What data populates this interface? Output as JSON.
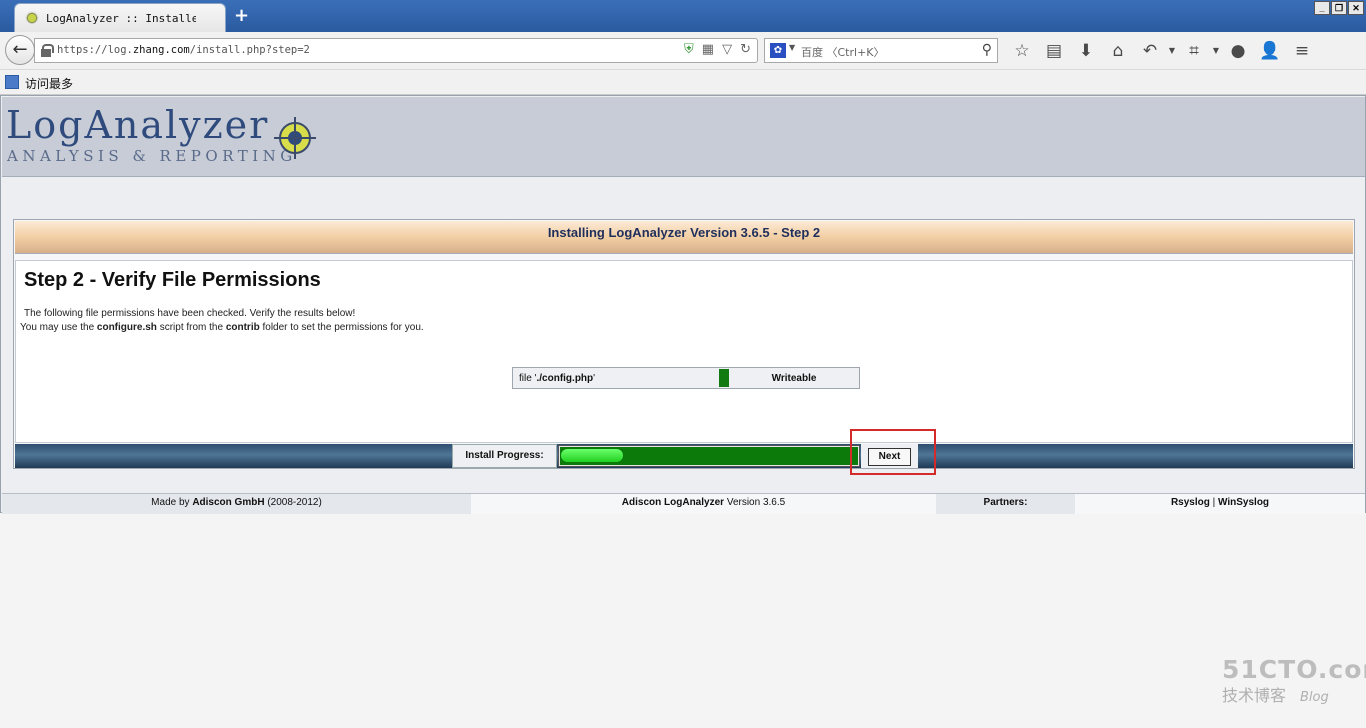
{
  "browser": {
    "tab_title": "LogAnalyzer :: Installe…",
    "new_tab_symbol": "+",
    "url_prefix": "https://log.",
    "url_host": "zhang.com",
    "url_path": "/install.php?step=2",
    "search_placeholder": "百度 〈Ctrl+K〉",
    "bookmark_label": "访问最多"
  },
  "logo": {
    "title": "LogAnalyzer",
    "subtitle": "ANALYSIS & REPORTING"
  },
  "install": {
    "title": "Installing LogAnalyzer Version 3.6.5 - Step 2",
    "heading": "Step 2 - Verify File Permissions",
    "desc_line1": "The following file permissions have been checked. Verify the results below!",
    "desc_line2_a": "You may use the ",
    "desc_line2_b": "configure.sh",
    "desc_line2_c": " script from the ",
    "desc_line2_d": "contrib",
    "desc_line2_e": " folder to set the permissions for you.",
    "permissions": [
      {
        "file_prefix": "file '",
        "file_name": "./config.php",
        "file_suffix": "'",
        "status": "Writeable"
      }
    ],
    "progress_label": "Install Progress:",
    "progress_value": 0.22,
    "next_label": "Next"
  },
  "footer": {
    "made_by_prefix": "Made by ",
    "made_by_company": "Adiscon GmbH",
    "made_by_years": " (2008-2012)",
    "product": "Adiscon LogAnalyzer",
    "version": " Version 3.6.5",
    "partners_label": "Partners:",
    "partner_1": "Rsyslog",
    "separator": " | ",
    "partner_2": "WinSyslog"
  },
  "watermark": {
    "top": "51CTO.com",
    "bottom": "技术博客",
    "blog": "Blog"
  },
  "colors": {
    "status_ok": "#117a11",
    "progress_fill": "#0b7a0b",
    "highlight": "#d42a2a"
  }
}
